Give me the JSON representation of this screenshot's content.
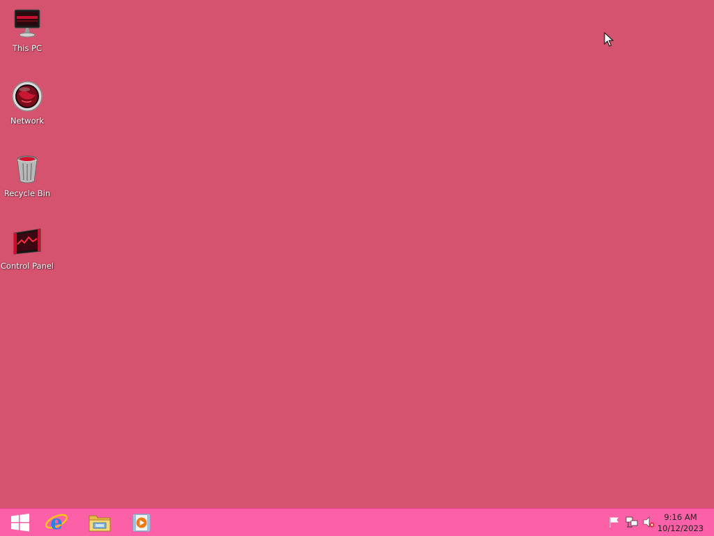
{
  "desktop": {
    "background": "#d6536f",
    "icons": [
      {
        "label": "This PC",
        "icon": "this-pc-icon"
      },
      {
        "label": "Network",
        "icon": "network-icon"
      },
      {
        "label": "Recycle Bin",
        "icon": "recycle-bin-icon"
      },
      {
        "label": "Control Panel",
        "icon": "control-panel-icon"
      }
    ]
  },
  "taskbar": {
    "background": "#fc61a8",
    "pinned": [
      {
        "name": "Start",
        "icon": "windows-logo-icon"
      },
      {
        "name": "Internet Explorer",
        "icon": "internet-explorer-icon"
      },
      {
        "name": "File Explorer",
        "icon": "file-explorer-icon"
      },
      {
        "name": "Windows Media Player",
        "icon": "media-player-icon"
      }
    ],
    "tray": [
      {
        "name": "Action Center",
        "icon": "flag-icon"
      },
      {
        "name": "Network",
        "icon": "network-tray-icon"
      },
      {
        "name": "Volume muted",
        "icon": "speaker-muted-icon"
      }
    ],
    "clock": {
      "time": "9:16 AM",
      "date": "10/12/2023"
    }
  }
}
